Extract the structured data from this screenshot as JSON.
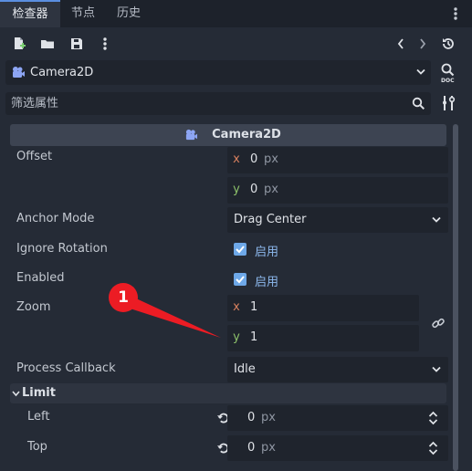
{
  "tabs": [
    {
      "label": "检查器",
      "active": true
    },
    {
      "label": "节点",
      "active": false
    },
    {
      "label": "历史",
      "active": false
    }
  ],
  "toolbar": {
    "icons": [
      "new-resource-icon",
      "open-folder-icon",
      "save-icon",
      "more-icon",
      "history-back-icon",
      "history-forward-icon",
      "object-history-icon"
    ]
  },
  "node_selector": {
    "name": "Camera2D",
    "icon": "camera2d-icon"
  },
  "filter": {
    "placeholder": "筛选属性"
  },
  "section": {
    "title": "Camera2D"
  },
  "properties": {
    "offset": {
      "label": "Offset",
      "x": "0",
      "y": "0",
      "unit": "px"
    },
    "anchor_mode": {
      "label": "Anchor Mode",
      "value": "Drag Center"
    },
    "ignore_rotation": {
      "label": "Ignore Rotation",
      "checked": true,
      "text": "启用"
    },
    "enabled": {
      "label": "Enabled",
      "checked": true,
      "text": "启用"
    },
    "zoom": {
      "label": "Zoom",
      "x": "1",
      "y": "1"
    },
    "process_callback": {
      "label": "Process Callback",
      "value": "Idle"
    }
  },
  "axis_labels": {
    "x": "x",
    "y": "y"
  },
  "limit": {
    "title": "Limit",
    "left": {
      "label": "Left",
      "value": "0",
      "unit": "px"
    },
    "top": {
      "label": "Top",
      "value": "0",
      "unit": "px"
    }
  },
  "annotation": {
    "label": "1",
    "color": "#ec1c24"
  },
  "colors": {
    "accent": "#5a8ee0",
    "checkbox": "#6ea8e8",
    "x_axis": "#d7805f",
    "y_axis": "#8cc06a"
  }
}
